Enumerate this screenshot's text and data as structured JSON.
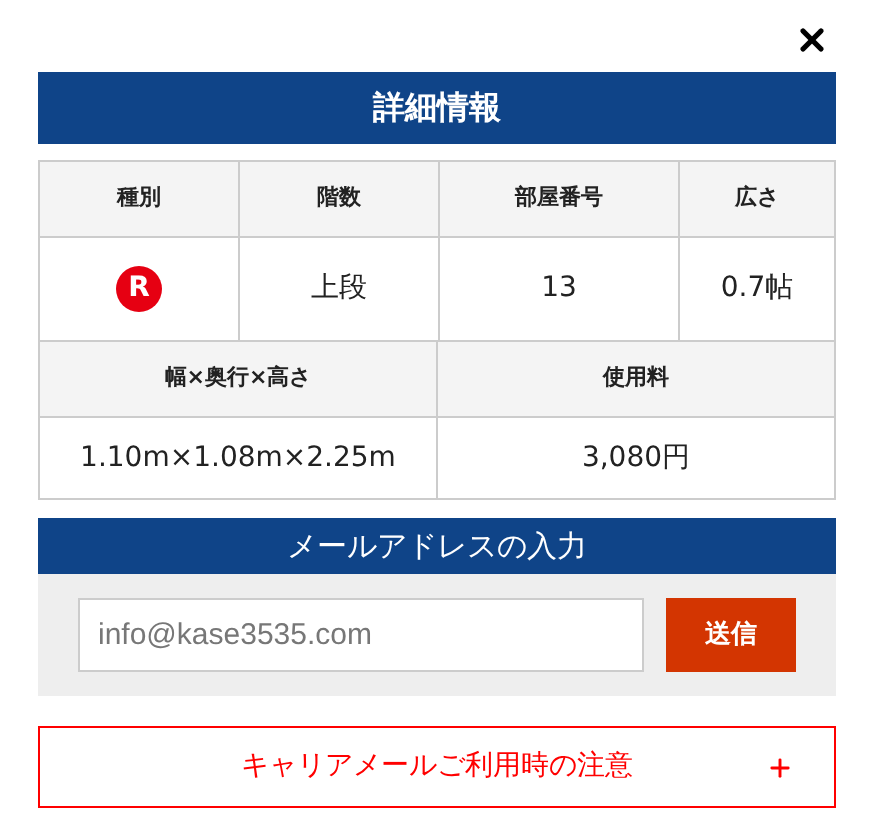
{
  "title": "詳細情報",
  "table_1": {
    "columns": [
      "種別",
      "階数",
      "部屋番号",
      "広さ"
    ],
    "row": [
      {
        "kind": "mark",
        "text": "R"
      },
      {
        "kind": "text",
        "text": "上段"
      },
      {
        "kind": "text",
        "text": "13"
      },
      {
        "kind": "text",
        "text": "0.7帖"
      }
    ]
  },
  "table_2": {
    "columns": [
      "幅×奥行×高さ",
      "使用料"
    ],
    "row": [
      "1.10m×1.08m×2.25m",
      "3,080円"
    ]
  },
  "email_section": {
    "title": "メールアドレスの入力",
    "placeholder": "info@kase3535.com",
    "button": "送信"
  },
  "accordion": {
    "label": "キャリアメールご利用時の注意",
    "expanded": false
  }
}
